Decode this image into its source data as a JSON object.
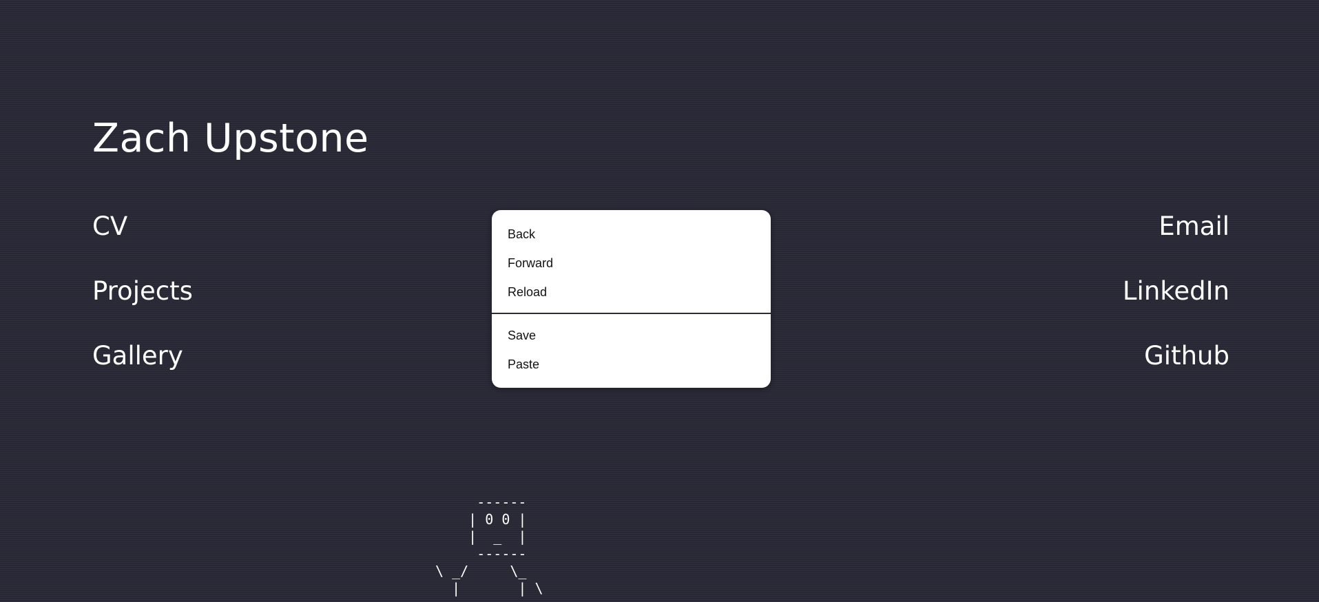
{
  "header": {
    "title": "Zach Upstone"
  },
  "nav": {
    "left": [
      {
        "label": "CV"
      },
      {
        "label": "Projects"
      },
      {
        "label": "Gallery"
      }
    ],
    "right": [
      {
        "label": "Email"
      },
      {
        "label": "LinkedIn"
      },
      {
        "label": "Github"
      }
    ]
  },
  "context_menu": {
    "items_top": [
      {
        "label": "Back"
      },
      {
        "label": "Forward"
      },
      {
        "label": "Reload"
      }
    ],
    "items_bottom": [
      {
        "label": "Save"
      },
      {
        "label": "Paste"
      }
    ]
  },
  "ascii_art": {
    "text": "     ------\n    | 0 0 |\n    |  _  |\n     ------\n\\ _/     \\_\n  |       | \\"
  },
  "colors": {
    "background": "#2b2a38",
    "text": "#ffffff",
    "menu_background": "#ffffff",
    "menu_text": "#111111"
  }
}
